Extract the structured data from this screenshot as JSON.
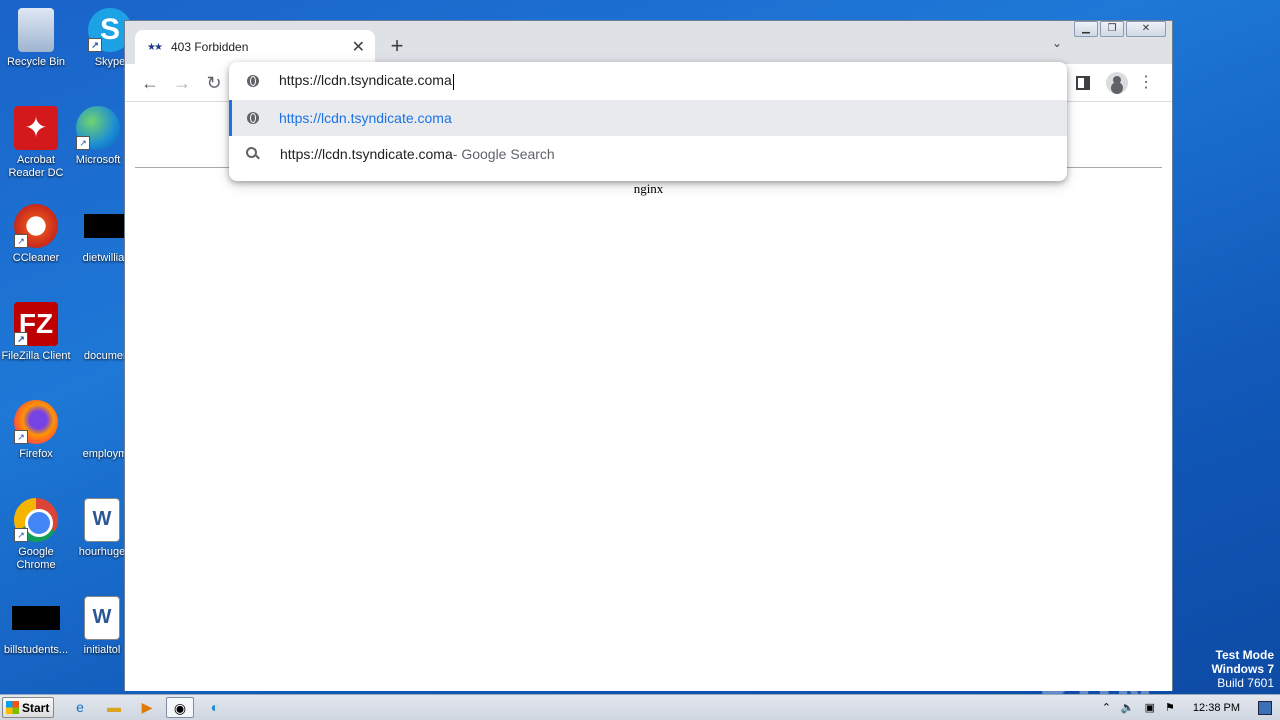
{
  "desktop": {
    "icons": [
      {
        "label": "Recycle Bin",
        "icon": "recycle-bin-icon"
      },
      {
        "label": "Skype",
        "icon": "skype-icon"
      },
      {
        "label": "Acrobat Reader DC",
        "icon": "acrobat-icon"
      },
      {
        "label": "Microsoft",
        "icon": "edge-icon"
      },
      {
        "label": "CCleaner",
        "icon": "ccleaner-icon"
      },
      {
        "label": "dietwilliam",
        "icon": "file-icon"
      },
      {
        "label": "FileZilla Client",
        "icon": "filezilla-icon"
      },
      {
        "label": "document",
        "icon": "file-icon"
      },
      {
        "label": "Firefox",
        "icon": "firefox-icon"
      },
      {
        "label": "employme",
        "icon": "file-icon"
      },
      {
        "label": "Google Chrome",
        "icon": "chrome-icon"
      },
      {
        "label": "hourhuge",
        "icon": "word-icon"
      },
      {
        "label": "billstudents...",
        "icon": "file-icon"
      },
      {
        "label": "initialtol",
        "icon": "word-icon"
      }
    ]
  },
  "browser": {
    "tab": {
      "title": "403 Forbidden"
    },
    "new_tab_symbol": "+",
    "omnibox": {
      "value": "https://lcdn.tsyndicate.coma",
      "suggestions": [
        {
          "text": "https://lcdn.tsyndicate.coma",
          "type": "url"
        },
        {
          "text": "https://lcdn.tsyndicate.coma",
          "suffix": " - Google Search",
          "type": "search"
        }
      ]
    },
    "page": {
      "server_text": "nginx"
    }
  },
  "watermark": {
    "text": "ANY RUN"
  },
  "system": {
    "test_mode": "Test Mode",
    "os": "Windows 7",
    "build": "Build 7601"
  },
  "taskbar": {
    "start_label": "Start",
    "clock": "12:38 PM"
  },
  "colors": {
    "accent": "#1a73e8",
    "desktop": "#1e78d6"
  }
}
